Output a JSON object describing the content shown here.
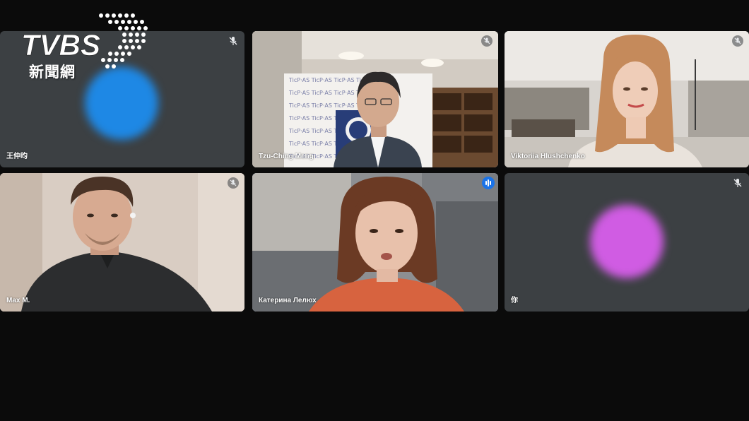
{
  "logo": {
    "wordmark": "TVBS",
    "subtitle": "新聞網"
  },
  "tiles": [
    {
      "name": "王仲昀",
      "muted": true,
      "video": false,
      "avatar_color": "#1e88e5"
    },
    {
      "name": "Tzu-Ching Meng",
      "muted": true,
      "video": true
    },
    {
      "name": "Viktoriia Hlushchenko",
      "muted": true,
      "video": true
    },
    {
      "name": "Max M.",
      "muted": true,
      "video": true
    },
    {
      "name": "Катерина Лелюх",
      "muted": false,
      "speaking": true,
      "video": true
    },
    {
      "name": "你",
      "muted": true,
      "video": false,
      "avatar_color": "#d05ce3"
    }
  ],
  "colors": {
    "background": "#0b0b0b",
    "tile_bg": "#3c4043",
    "active_speaker_border": "#8ab4f8",
    "speaking_indicator": "#1a73e8"
  }
}
